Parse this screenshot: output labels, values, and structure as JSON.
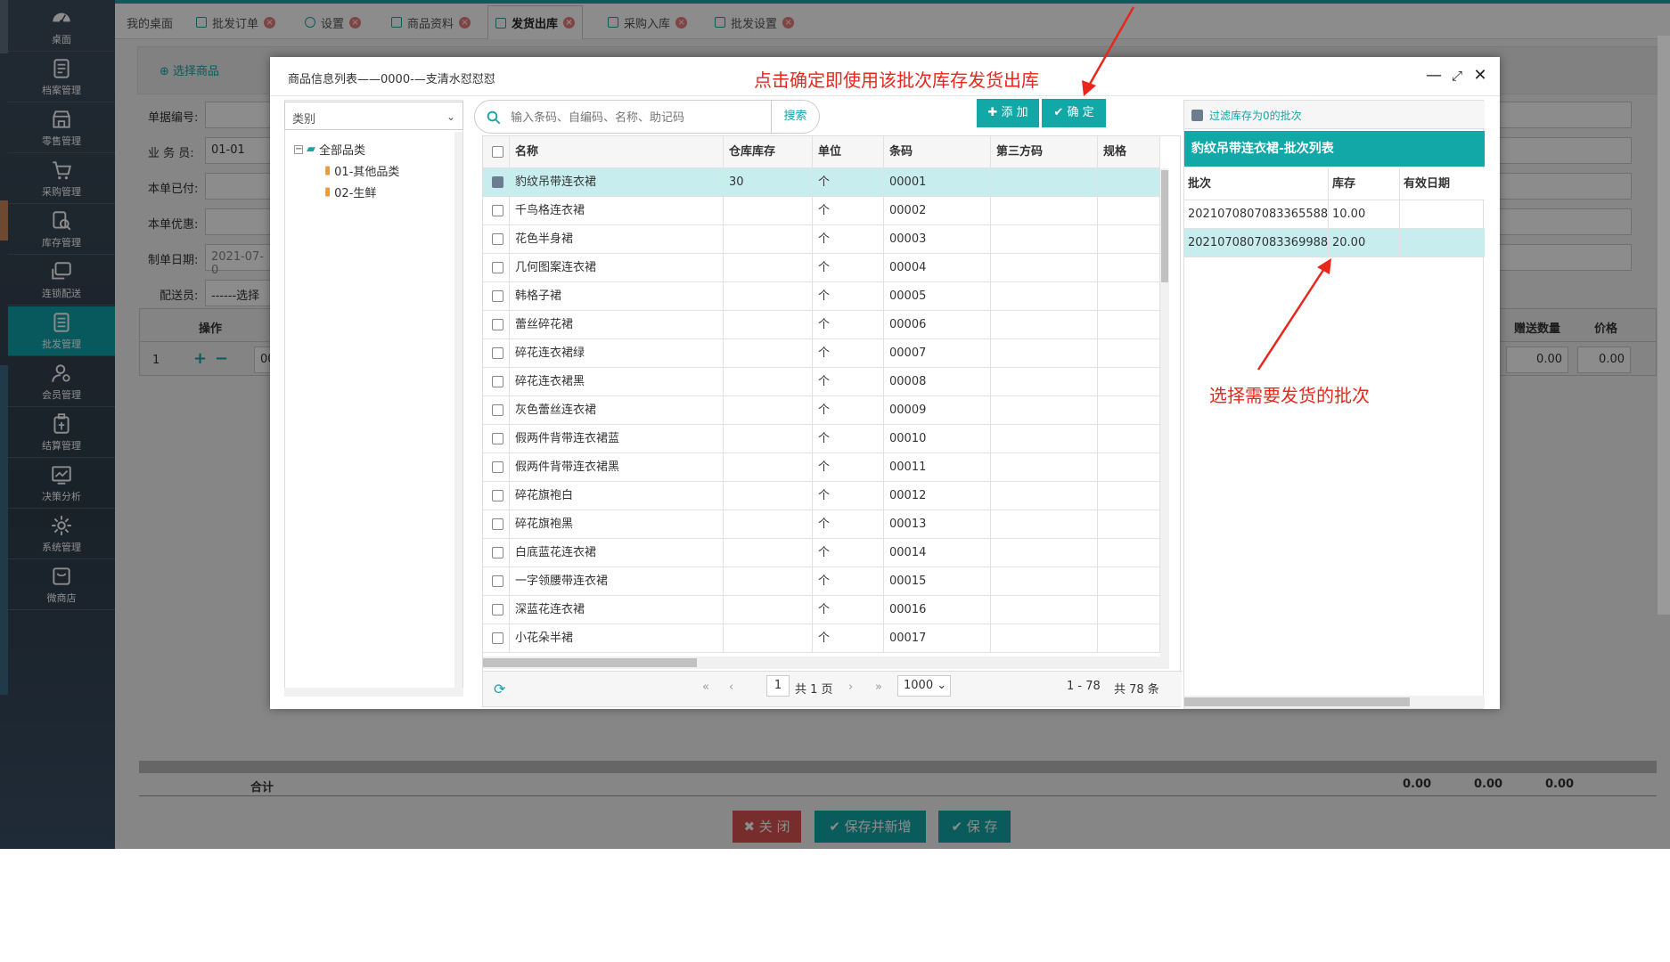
{
  "sidebar": {
    "items": [
      {
        "label": "桌面",
        "icon": "dashboard-icon"
      },
      {
        "label": "档案管理",
        "icon": "archive-icon"
      },
      {
        "label": "零售管理",
        "icon": "store-icon"
      },
      {
        "label": "采购管理",
        "icon": "cart-icon"
      },
      {
        "label": "库存管理",
        "icon": "inventory-icon"
      },
      {
        "label": "连锁配送",
        "icon": "delivery-icon"
      },
      {
        "label": "批发管理",
        "icon": "wholesale-icon"
      },
      {
        "label": "会员管理",
        "icon": "member-icon"
      },
      {
        "label": "结算管理",
        "icon": "settlement-icon"
      },
      {
        "label": "决策分析",
        "icon": "analysis-icon"
      },
      {
        "label": "系统管理",
        "icon": "gear-icon"
      },
      {
        "label": "微商店",
        "icon": "shop-icon"
      }
    ]
  },
  "tabs": [
    {
      "label": "我的桌面"
    },
    {
      "label": "批发订单"
    },
    {
      "label": "设置"
    },
    {
      "label": "商品资料"
    },
    {
      "label": "发货出库"
    },
    {
      "label": "采购入库"
    },
    {
      "label": "批发设置"
    }
  ],
  "bgform": {
    "select_goods": "选择商品",
    "labels": [
      "单据编号:",
      "业 务 员:",
      "本单已付:",
      "本单优惠:",
      "制单日期:",
      "配送员:"
    ],
    "salesman": "01-01",
    "date": "2021-07-0",
    "deliverer": "------选择",
    "col_op": "操作",
    "col_gift": "赠送数量",
    "col_price": "价格",
    "row_no": "1",
    "row_code": "00",
    "gift_val": "0.00",
    "price_val": "0.00",
    "total_label": "合计",
    "totals": [
      "0.00",
      "0.00",
      "0.00"
    ],
    "close_btn": "关 闭",
    "save_new_btn": "保存并新增",
    "save_btn": "保 存"
  },
  "dialog": {
    "title": "商品信息列表——0000-—支清水怼怼怼",
    "category_placeholder": "类别",
    "tree": {
      "root": "全部品类",
      "children": [
        "01-其他品类",
        "02-生鲜"
      ]
    },
    "search_placeholder": "输入条码、自编码、名称、助记码",
    "search_btn": "搜索",
    "add_btn": "添 加",
    "confirm_btn": "确 定",
    "columns": [
      "名称",
      "仓库库存",
      "单位",
      "条码",
      "第三方码",
      "规格"
    ],
    "rows": [
      {
        "name": "豹纹吊带连衣裙",
        "stock": "30",
        "unit": "个",
        "code": "00001",
        "checked": true
      },
      {
        "name": "千鸟格连衣裙",
        "stock": "",
        "unit": "个",
        "code": "00002",
        "checked": false
      },
      {
        "name": "花色半身裙",
        "stock": "",
        "unit": "个",
        "code": "00003",
        "checked": false
      },
      {
        "name": "几何图案连衣裙",
        "stock": "",
        "unit": "个",
        "code": "00004",
        "checked": false
      },
      {
        "name": "韩格子裙",
        "stock": "",
        "unit": "个",
        "code": "00005",
        "checked": false
      },
      {
        "name": "蕾丝碎花裙",
        "stock": "",
        "unit": "个",
        "code": "00006",
        "checked": false
      },
      {
        "name": "碎花连衣裙绿",
        "stock": "",
        "unit": "个",
        "code": "00007",
        "checked": false
      },
      {
        "name": "碎花连衣裙黑",
        "stock": "",
        "unit": "个",
        "code": "00008",
        "checked": false
      },
      {
        "name": "灰色蕾丝连衣裙",
        "stock": "",
        "unit": "个",
        "code": "00009",
        "checked": false
      },
      {
        "name": "假两件背带连衣裙蓝",
        "stock": "",
        "unit": "个",
        "code": "00010",
        "checked": false
      },
      {
        "name": "假两件背带连衣裙黑",
        "stock": "",
        "unit": "个",
        "code": "00011",
        "checked": false
      },
      {
        "name": "碎花旗袍白",
        "stock": "",
        "unit": "个",
        "code": "00012",
        "checked": false
      },
      {
        "name": "碎花旗袍黑",
        "stock": "",
        "unit": "个",
        "code": "00013",
        "checked": false
      },
      {
        "name": "白底蓝花连衣裙",
        "stock": "",
        "unit": "个",
        "code": "00014",
        "checked": false
      },
      {
        "name": "一字领腰带连衣裙",
        "stock": "",
        "unit": "个",
        "code": "00015",
        "checked": false
      },
      {
        "name": "深蓝花连衣裙",
        "stock": "",
        "unit": "个",
        "code": "00016",
        "checked": false
      },
      {
        "name": "小花朵半裙",
        "stock": "",
        "unit": "个",
        "code": "00017",
        "checked": false
      }
    ],
    "pager": {
      "page": "1",
      "total_pages": "共 1 页",
      "page_size": "1000",
      "range": "1 - 78",
      "total": "共 78 条"
    },
    "batch": {
      "filter_label": "过滤库存为0的批次",
      "title": "豹纹吊带连衣裙-批次列表",
      "columns": [
        "批次",
        "库存",
        "有效日期"
      ],
      "rows": [
        {
          "batch": "20210708070833655887",
          "stock": "10.00",
          "date": ""
        },
        {
          "batch": "20210708070833699889",
          "stock": "20.00",
          "date": ""
        }
      ]
    },
    "annotations": {
      "top": "点击确定即使用该批次库存发货出库",
      "right": "选择需要发货的批次"
    }
  },
  "colors": {
    "accent": "#13a8a8",
    "annotation": "#e8261c",
    "sidebar": "#34424f"
  }
}
